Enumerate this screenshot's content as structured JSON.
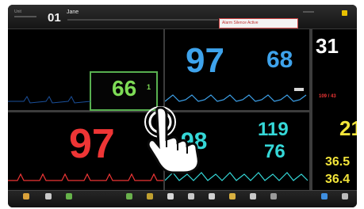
{
  "header": {
    "unit_label": "Unit",
    "bed_number": "01",
    "patient_name": "Jane",
    "alarm_message": "Alarm Silence Active",
    "alarm_color": "#c03030",
    "icon": "alarm-bell-icon"
  },
  "vitals": {
    "spo2_main": "97",
    "spo2_secondary": "68",
    "pulse": "66",
    "pulse_small": "1",
    "ecg_hr": "97",
    "bp_partial": "98",
    "bp_sys": "119",
    "bp_dia": "76",
    "right_top": "31",
    "right_red": "109 / 43",
    "right_yellow_top": "21",
    "right_yellow_1": "36.5",
    "right_yellow_2": "36.4"
  },
  "colors": {
    "blue": "#3ea3ec",
    "green": "#7edc56",
    "red": "#ee3535",
    "cyan": "#35d8d8",
    "yellow": "#f2e43a",
    "white": "#ffffff"
  },
  "footer": {
    "buttons": [
      {
        "icon": "alarms-icon"
      },
      {
        "icon": "patient-icon"
      },
      {
        "icon": "review-icon"
      },
      {
        "icon": "nibp-icon"
      },
      {
        "icon": "trends-icon"
      },
      {
        "icon": "zero-icon"
      },
      {
        "icon": "audio-icon"
      },
      {
        "icon": "freeze-icon"
      },
      {
        "icon": "home-icon"
      },
      {
        "icon": "print-icon"
      },
      {
        "icon": "setup-icon"
      },
      {
        "icon": "monitor-icon"
      },
      {
        "icon": "config-icon"
      }
    ]
  }
}
